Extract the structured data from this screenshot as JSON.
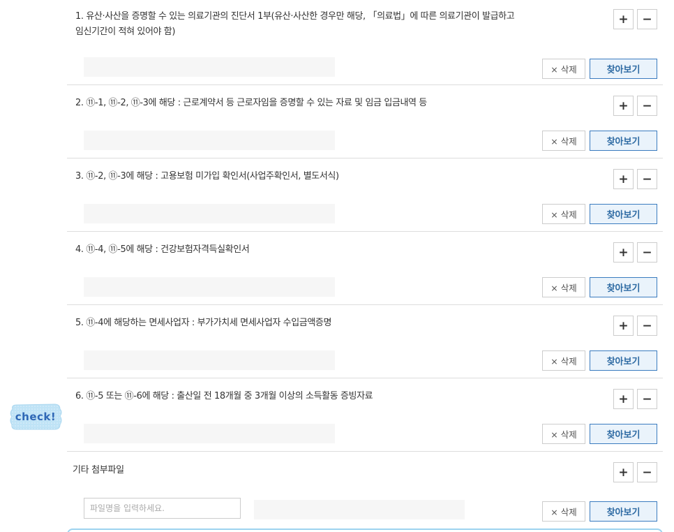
{
  "rows": [
    {
      "title": "1. 유산·사산을 증명할 수 있는 의료기관의 진단서 1부(유산·사산한 경우만 해당, 「의료법」에 따른 의료기관이 발급하고 임신기간이 적혀 있어야 함)",
      "plus": "+",
      "minus": "−",
      "delete_label": "× 삭제",
      "find_label": "찾아보기"
    },
    {
      "title": "2. ⑪-1, ⑪-2, ⑪-3에 해당 : 근로계약서 등 근로자임을 증명할 수 있는 자료 및 임금 입금내역 등",
      "plus": "+",
      "minus": "−",
      "delete_label": "× 삭제",
      "find_label": "찾아보기"
    },
    {
      "title": "3. ⑪-2, ⑪-3에 해당 : 고용보험 미가입 확인서(사업주확인서, 별도서식)",
      "plus": "+",
      "minus": "−",
      "delete_label": "× 삭제",
      "find_label": "찾아보기"
    },
    {
      "title": "4. ⑪-4, ⑪-5에 해당 : 건강보험자격득실확인서",
      "plus": "+",
      "minus": "−",
      "delete_label": "× 삭제",
      "find_label": "찾아보기"
    },
    {
      "title": "5. ⑪-4에 해당하는 면세사업자 : 부가가치세 면세사업자 수입금액증명",
      "plus": "+",
      "minus": "−",
      "delete_label": "× 삭제",
      "find_label": "찾아보기"
    },
    {
      "title": "6. ⑪-5 또는 ⑪-6에 해당 : 출산일 전 18개월 중 3개월 이상의 소득활동 증빙자료",
      "plus": "+",
      "minus": "−",
      "delete_label": "× 삭제",
      "find_label": "찾아보기"
    }
  ],
  "other": {
    "title": "기타 첨부파일",
    "plus": "+",
    "minus": "−",
    "filename_placeholder": "파일명을 입력하세요.",
    "delete_label": "× 삭제",
    "find_label": "찾아보기"
  },
  "badge": {
    "text": "check!"
  },
  "colors": {
    "find_border": "#3a7bbf",
    "find_bg": "#eaf3fb",
    "badge_fill": "#bfe3f6",
    "border": "#dddddd"
  }
}
